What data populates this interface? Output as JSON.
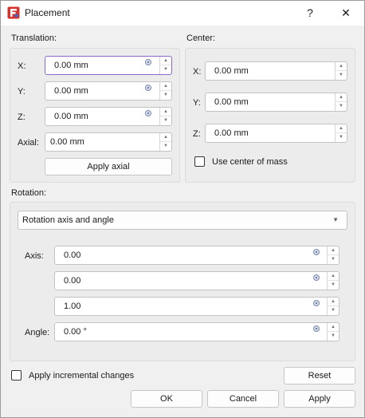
{
  "window": {
    "title": "Placement",
    "help": "?",
    "close": "✕",
    "app_icon": "freecad-icon"
  },
  "translation": {
    "label": "Translation:",
    "x": {
      "label": "X:",
      "value": "0.00 mm"
    },
    "y": {
      "label": "Y:",
      "value": "0.00 mm"
    },
    "z": {
      "label": "Z:",
      "value": "0.00 mm"
    },
    "axial": {
      "label": "Axial:",
      "value": "0.00 mm"
    },
    "apply_axial": "Apply axial"
  },
  "center": {
    "label": "Center:",
    "x": {
      "label": "X:",
      "value": "0.00 mm"
    },
    "y": {
      "label": "Y:",
      "value": "0.00 mm"
    },
    "z": {
      "label": "Z:",
      "value": "0.00 mm"
    },
    "use_center_of_mass": {
      "label": "Use center of mass",
      "checked": false
    }
  },
  "rotation": {
    "label": "Rotation:",
    "mode": "Rotation axis and angle",
    "axis_label": "Axis:",
    "axis_x": "0.00",
    "axis_y": "0.00",
    "axis_z": "1.00",
    "angle_label": "Angle:",
    "angle": "0.00 °"
  },
  "footer": {
    "incremental": {
      "label": "Apply incremental changes",
      "checked": false
    },
    "reset": "Reset",
    "ok": "OK",
    "cancel": "Cancel",
    "apply": "Apply"
  },
  "colors": {
    "focus_border": "#8c6bc8",
    "app_icon_red": "#d6332f",
    "app_icon_blue": "#3d64c8"
  }
}
